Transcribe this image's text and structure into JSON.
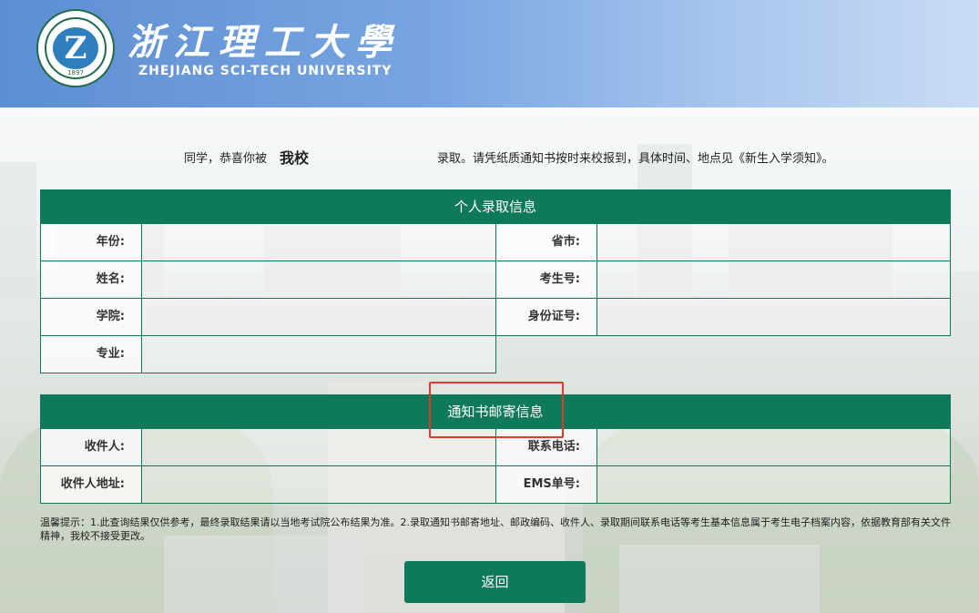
{
  "header": {
    "logo_year": "1897",
    "name_cn": "浙江理工大學",
    "name_en": "ZHEJIANG SCI-TECH UNIVERSITY"
  },
  "greeting": {
    "part1": "同学，恭喜你被",
    "school": "我校",
    "part2": "录取。请凭纸质通知书按时来校报到，具体时间、地点见《新生入学须知》。"
  },
  "admission_info": {
    "title": "个人录取信息",
    "fields": {
      "year": {
        "label": "年份:",
        "value": ""
      },
      "province": {
        "label": "省市:",
        "value": ""
      },
      "name": {
        "label": "姓名:",
        "value": ""
      },
      "exam_no": {
        "label": "考生号:",
        "value": ""
      },
      "college": {
        "label": "学院:",
        "value": ""
      },
      "id_no": {
        "label": "身份证号:",
        "value": ""
      },
      "major": {
        "label": "专业:",
        "value": ""
      }
    }
  },
  "mail_info": {
    "title": "通知书邮寄信息",
    "fields": {
      "recipient": {
        "label": "收件人:",
        "value": ""
      },
      "phone": {
        "label": "联系电话:",
        "value": ""
      },
      "address": {
        "label": "收件人地址:",
        "value": ""
      },
      "ems": {
        "label": "EMS单号:",
        "value": ""
      }
    }
  },
  "tips": "温馨提示：1.此查询结果仅供参考，最终录取结果请以当地考试院公布结果为准。2.录取通知书邮寄地址、邮政编码、收件人、录取期间联系电话等考生基本信息属于考生电子档案内容，依据教育部有关文件精神，我校不接受更改。",
  "back_button": "返回",
  "colors": {
    "accent": "#0f7a5a",
    "highlight": "#e03a2a",
    "header": "#5d8ed3"
  }
}
